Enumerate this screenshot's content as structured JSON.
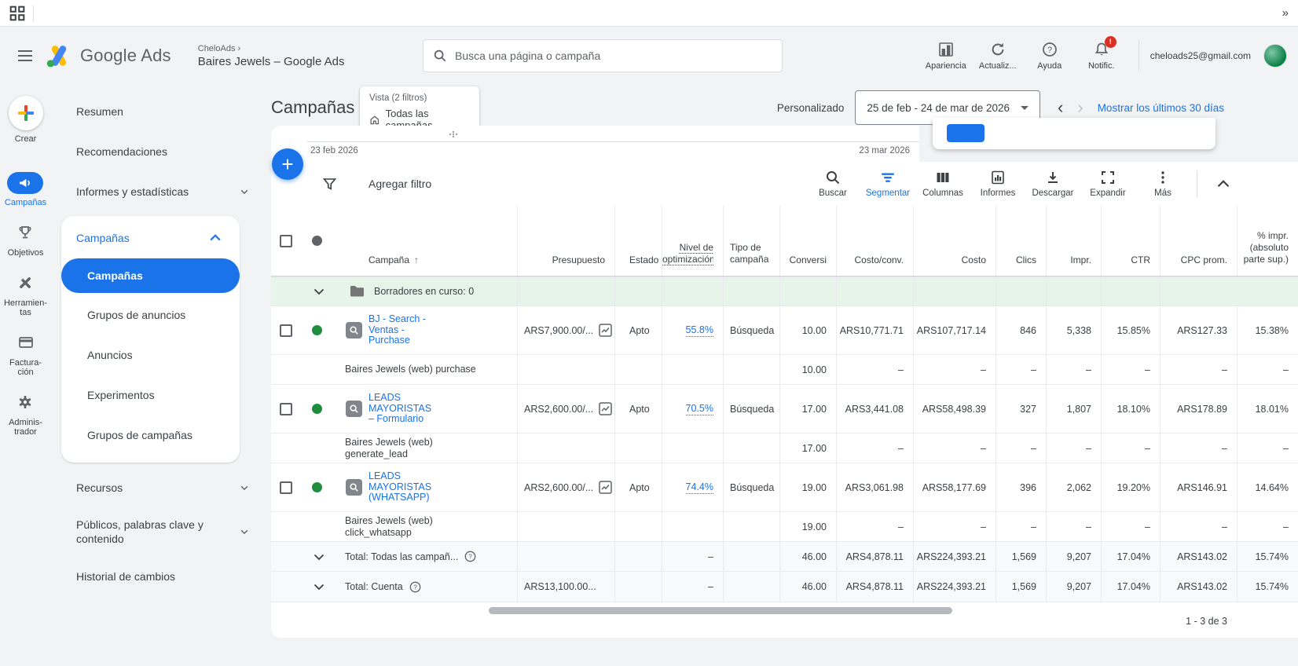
{
  "colors": {
    "accent": "#1a73e8",
    "status_green": "#1e8e3e",
    "drafts_bg": "#e6f4ea",
    "badge_red": "#d93025"
  },
  "browser": {
    "overflow_chevrons": "»"
  },
  "header": {
    "logo_text": "Google Ads",
    "breadcrumb": "CheloAds",
    "breadcrumb_sep": "›",
    "account_title": "Baires Jewels – Google Ads",
    "search_placeholder": "Busca una página o campaña",
    "actions": {
      "apariencia": "Apariencia",
      "actualizar": "Actualiz...",
      "ayuda": "Ayuda",
      "notific": "Notific.",
      "notific_badge": "!"
    },
    "email": "cheloads25@gmail.com"
  },
  "rail": {
    "crear": "Crear",
    "campanas": "Campañas",
    "objetivos": "Objetivos",
    "herramientas": "Herramien-\ntas",
    "facturacion": "Factura-\nción",
    "administrador": "Adminis-\ntrador"
  },
  "nav": {
    "resumen": "Resumen",
    "recomendaciones": "Recomendaciones",
    "informes": "Informes y estadísticas",
    "grupo": "Campañas",
    "sub": [
      "Campañas",
      "Grupos de anuncios",
      "Anuncios",
      "Experimentos",
      "Grupos de campañas"
    ],
    "recursos": "Recursos",
    "publicos": "Públicos, palabras clave y contenido",
    "historial": "Historial de cambios"
  },
  "page": {
    "title": "Campañas",
    "vista_label": "Vista (2 filtros)",
    "vista_value": "Todas las campañas",
    "date_mode": "Personalizado",
    "date_range": "25 de feb - 24 de mar de 2026",
    "prev": "‹",
    "next": "›",
    "show_last_30": "Mostrar los últimos 30 días",
    "chart_start": "23 feb 2026",
    "chart_end": "23 mar 2026",
    "pagination": "1 - 3 de 3"
  },
  "toolbar": {
    "filter": "Agregar filtro",
    "buscar": "Buscar",
    "segmentar": "Segmentar",
    "columnas": "Columnas",
    "informes": "Informes",
    "descargar": "Descargar",
    "expandir": "Expandir",
    "mas": "Más"
  },
  "table": {
    "headers": {
      "campana": "Campaña",
      "sort_arrow": "↑",
      "presupuesto": "Presupuesto",
      "estado": "Estado",
      "nivel": "Nivel de optimización",
      "tipo": "Tipo de campaña",
      "conversiones": "Conversi",
      "costo_conv": "Costo/conv.",
      "costo": "Costo",
      "clics": "Clics",
      "impr": "Impr.",
      "ctr": "CTR",
      "cpc_prom": "CPC prom.",
      "impr_abs": "% impr. (absoluto parte sup.)"
    },
    "drafts_label": "Borradores en curso: 0",
    "rows": [
      {
        "name": "BJ - Search - Ventas - Purchase",
        "budget": "ARS7,900.00/...",
        "estado": "Apto",
        "nivel": "55.8%",
        "tipo": "Búsqueda",
        "conv": "10.00",
        "costo_conv": "ARS10,771.71",
        "costo": "ARS107,717.14",
        "clics": "846",
        "impr": "5,338",
        "ctr": "15.85%",
        "cpc": "ARS127.33",
        "pimpr": "15.38%",
        "sub_label": "Baires Jewels (web) purchase",
        "sub_conv": "10.00",
        "dash": "–"
      },
      {
        "name": "LEADS MAYORISTAS – Formulario",
        "budget": "ARS2,600.00/...",
        "estado": "Apto",
        "nivel": "70.5%",
        "tipo": "Búsqueda",
        "conv": "17.00",
        "costo_conv": "ARS3,441.08",
        "costo": "ARS58,498.39",
        "clics": "327",
        "impr": "1,807",
        "ctr": "18.10%",
        "cpc": "ARS178.89",
        "pimpr": "18.01%",
        "sub_label": "Baires Jewels (web) generate_lead",
        "sub_conv": "17.00",
        "dash": "–"
      },
      {
        "name": "LEADS MAYORISTAS (WHATSAPP)",
        "budget": "ARS2,600.00/...",
        "estado": "Apto",
        "nivel": "74.4%",
        "tipo": "Búsqueda",
        "conv": "19.00",
        "costo_conv": "ARS3,061.98",
        "costo": "ARS58,177.69",
        "clics": "396",
        "impr": "2,062",
        "ctr": "19.20%",
        "cpc": "ARS146.91",
        "pimpr": "14.64%",
        "sub_label": "Baires Jewels (web) click_whatsapp",
        "sub_conv": "19.00",
        "dash": "–"
      }
    ],
    "totals": [
      {
        "label": "Total: Todas las campañ...",
        "budget": "",
        "nivel": "–",
        "conv": "46.00",
        "costo_conv": "ARS4,878.11",
        "costo": "ARS224,393.21",
        "clics": "1,569",
        "impr": "9,207",
        "ctr": "17.04%",
        "cpc": "ARS143.02",
        "pimpr": "15.74%"
      },
      {
        "label": "Total: Cuenta",
        "budget": "ARS13,100.00...",
        "nivel": "–",
        "conv": "46.00",
        "costo_conv": "ARS4,878.11",
        "costo": "ARS224,393.21",
        "clics": "1,569",
        "impr": "9,207",
        "ctr": "17.04%",
        "cpc": "ARS143.02",
        "pimpr": "15.74%"
      }
    ]
  }
}
